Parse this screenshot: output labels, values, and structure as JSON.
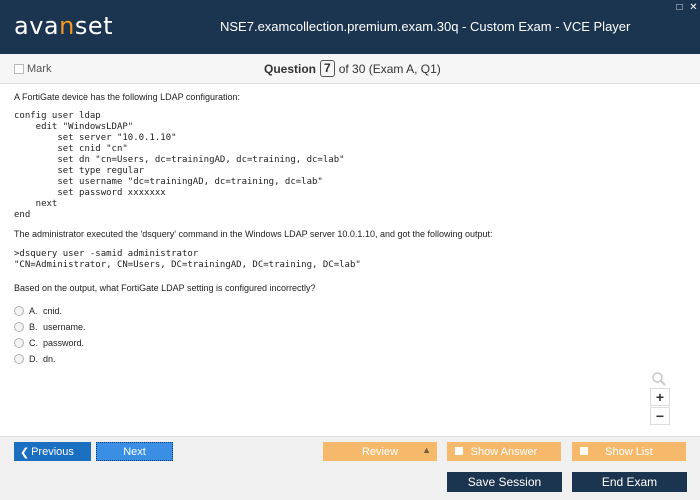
{
  "app": {
    "logo_pre": "ava",
    "logo_accent": "n",
    "logo_post": "set",
    "window_title": "NSE7.examcollection.premium.exam.30q - Custom Exam - VCE Player",
    "restore_glyph": "□",
    "close_glyph": "✕"
  },
  "question_bar": {
    "mark_label": "Mark",
    "question_label": "Question",
    "question_number": "7",
    "question_suffix": "of 30 (Exam A, Q1)"
  },
  "question": {
    "intro": "A FortiGate device has the following LDAP configuration:",
    "config": "config user ldap\n    edit \"WindowsLDAP\"\n        set server \"10.0.1.10\"\n        set cnid \"cn\"\n        set dn \"cn=Users, dc=trainingAD, dc=training, dc=lab\"\n        set type regular\n        set username \"dc=trainingAD, dc=training, dc=lab\"\n        set password xxxxxxx\n    next\nend",
    "middle": "The administrator executed the 'dsquery' command in the Windows LDAP server 10.0.1.10, and got the following output:",
    "output": ">dsquery user -samid administrator\n\"CN=Administrator, CN=Users, DC=trainingAD, DC=training, DC=lab\"",
    "ask": "Based on the output, what FortiGate LDAP setting is configured incorrectly?",
    "options": [
      {
        "letter": "A.",
        "text": "cnid."
      },
      {
        "letter": "B.",
        "text": "username."
      },
      {
        "letter": "C.",
        "text": "password."
      },
      {
        "letter": "D.",
        "text": "dn."
      }
    ]
  },
  "zoom": {
    "in_label": "+",
    "out_label": "−"
  },
  "toolbar": {
    "previous_label": "Previous",
    "previous_arrow": "❮",
    "next_label": "Next",
    "review_label": "Review",
    "review_arrow": "▲",
    "show_answer_label": "Show Answer",
    "show_list_label": "Show List"
  },
  "bottom": {
    "save_session_label": "Save Session",
    "end_exam_label": "End Exam"
  },
  "colors": {
    "title_bar": "#1b3550",
    "logo_accent": "#f39a1e",
    "primary_button": "#1b6fc1",
    "secondary_button": "#f6b86b"
  },
  "icons": [
    "restore-icon",
    "close-icon",
    "checkbox-icon",
    "radio-icon",
    "magnifier-icon",
    "chevron-left-icon",
    "caret-up-icon"
  ]
}
